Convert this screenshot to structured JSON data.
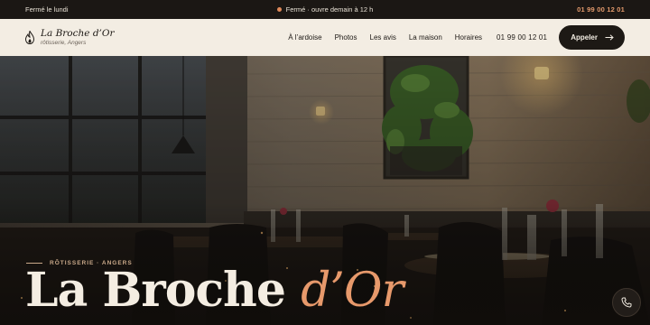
{
  "topbar": {
    "hours_note": "Fermé le lundi",
    "status": "Fermé · ouvre demain à 12 h",
    "phone": "01 99 00 12 01"
  },
  "header": {
    "brand_name": "La Broche d’Or",
    "brand_sub": "rôtisserie, Angers",
    "nav": [
      "À l’ardoise",
      "Photos",
      "Les avis",
      "La maison",
      "Horaires"
    ],
    "phone": "01 99 00 12 01",
    "call_label": "Appeler"
  },
  "hero": {
    "kicker": "RÔTISSERIE · ANGERS",
    "title_main": "La Broche",
    "title_accent": "d’Or"
  },
  "colors": {
    "accent": "#e7996b",
    "dark": "#1d1915",
    "cream": "#f3ede3"
  },
  "icons": [
    "flame-icon",
    "arrow-right-icon",
    "phone-icon"
  ]
}
